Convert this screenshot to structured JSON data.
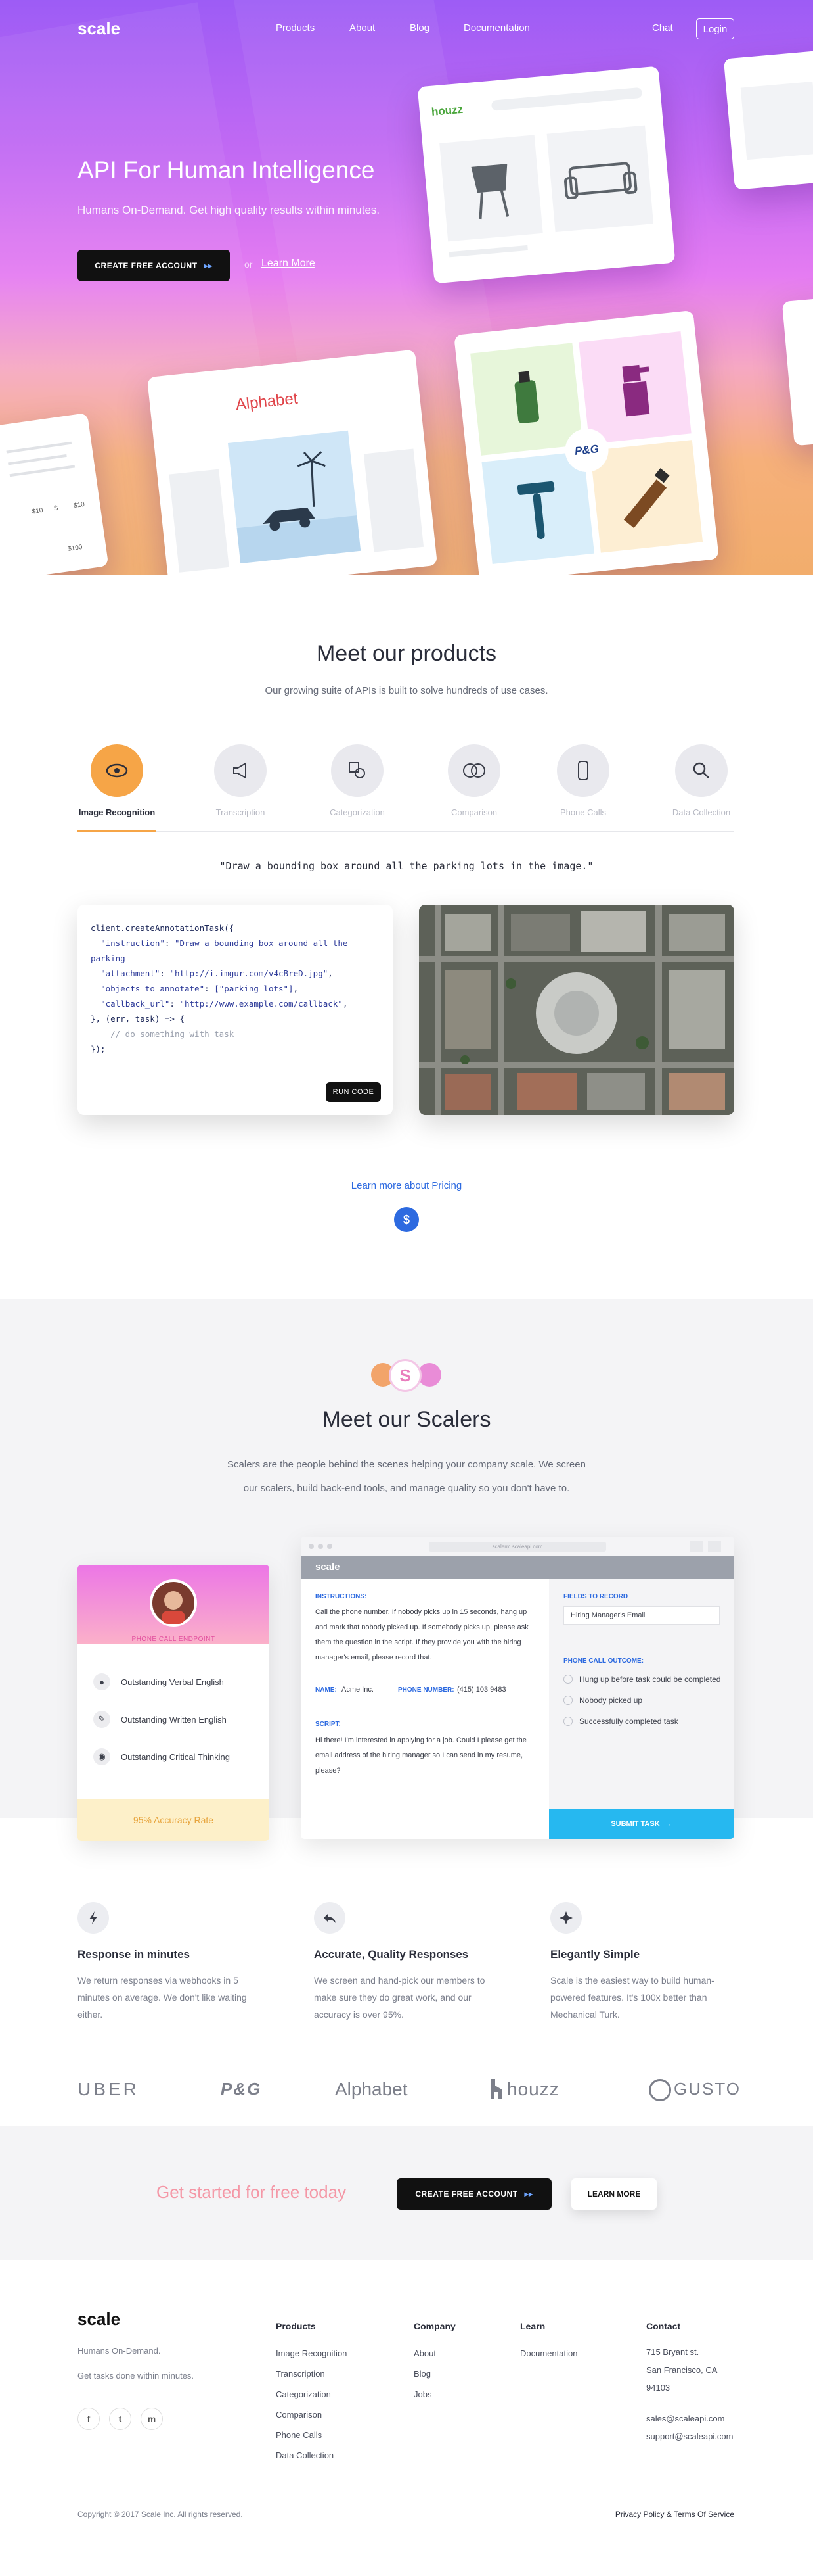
{
  "nav": {
    "logo": "scale",
    "links": [
      "Products",
      "About",
      "Blog",
      "Documentation"
    ],
    "chat": "Chat",
    "login": "Login"
  },
  "hero": {
    "title": "API For Human Intelligence",
    "subtitle": "Humans On-Demand. Get high quality results within minutes.",
    "cta": "CREATE FREE ACCOUNT",
    "or": "or",
    "learn_more": "Learn More",
    "cards": {
      "houzz": "houzz",
      "alphabet": "Alphabet",
      "pg": "P&G",
      "prices": [
        "$10",
        "$",
        "$10",
        "$100"
      ]
    }
  },
  "products": {
    "title": "Meet our products",
    "subtitle": "Our growing suite of APIs is built to solve hundreds of use cases.",
    "tabs": [
      {
        "label": "Image Recognition",
        "icon": "eye-icon",
        "active": true
      },
      {
        "label": "Transcription",
        "icon": "megaphone-icon",
        "active": false
      },
      {
        "label": "Categorization",
        "icon": "shapes-icon",
        "active": false
      },
      {
        "label": "Comparison",
        "icon": "rings-icon",
        "active": false
      },
      {
        "label": "Phone Calls",
        "icon": "phone-icon",
        "active": false
      },
      {
        "label": "Data Collection",
        "icon": "search-icon",
        "active": false
      }
    ],
    "instruction": "\"Draw a bounding box around all the parking lots in the image.\"",
    "code": {
      "line1": "client.createAnnotationTask({",
      "line2_key": "\"instruction\"",
      "line2_val": "\"Draw a bounding box around all the parking",
      "line3_key": "\"attachment\"",
      "line3_val": "\"http://i.imgur.com/v4cBreD.jpg\"",
      "line4_key": "\"objects_to_annotate\"",
      "line4_val": "[\"parking lots\"]",
      "line5_key": "\"callback_url\"",
      "line5_val": "\"http://www.example.com/callback\"",
      "line6": "}, (err, task) => {",
      "line7": "// do something with task",
      "line8": "});",
      "run": "RUN CODE"
    },
    "pricing_link": "Learn more about Pricing",
    "pricing_icon": "$"
  },
  "scalers": {
    "badge": "S",
    "title": "Meet our Scalers",
    "subtitle_1": "Scalers are the people behind the scenes helping your company scale. We screen",
    "subtitle_2": "our scalers, build back-end tools, and manage quality so you don't have to.",
    "profile": {
      "role": "PHONE CALL ENDPOINT",
      "skills": [
        "Outstanding Verbal English",
        "Outstanding Written English",
        "Outstanding Critical Thinking"
      ],
      "accuracy": "95% Accuracy Rate"
    },
    "browser": {
      "url": "scalerm.scaleapi.com",
      "app": "scale",
      "instructions_label": "INSTRUCTIONS:",
      "instructions": "Call the phone number. If nobody picks up in 15 seconds, hang up and mark that nobody picked up. If somebody picks up, please ask them the question in the script. If they provide you with the hiring manager's email, please record that.",
      "name_label": "NAME:",
      "name": "Acme Inc.",
      "phone_label": "PHONE NUMBER:",
      "phone": "(415) 103 9483",
      "script_label": "SCRIPT:",
      "script": "Hi there! I'm interested in applying for a job. Could I please get the email address of the hiring manager so I can send in my resume, please?",
      "fields_label": "FIELDS TO RECORD",
      "field_placeholder": "Hiring Manager's Email",
      "outcome_label": "PHONE CALL OUTCOME:",
      "outcomes": [
        "Hung up before task could be completed",
        "Nobody picked up",
        "Successfully completed task"
      ],
      "submit": "SUBMIT TASK"
    }
  },
  "features": [
    {
      "icon": "lightning-icon",
      "title": "Response in minutes",
      "text": "We return responses via webhooks in 5 minutes on average. We don't like waiting either."
    },
    {
      "icon": "reply-arrow-icon",
      "title": "Accurate, Quality Responses",
      "text": "We screen and hand-pick our members to make sure they do great work, and our accuracy is over 95%."
    },
    {
      "icon": "sparkle-icon",
      "title": "Elegantly Simple",
      "text": "Scale is the easiest way to build human-powered features. It's 100x better than Mechanical Turk."
    }
  ],
  "clients": [
    "UBER",
    "P&G",
    "Alphabet",
    "houzz",
    "GUSTO"
  ],
  "cta": {
    "text": "Get started for free today",
    "primary": "CREATE FREE ACCOUNT",
    "secondary": "LEARN MORE"
  },
  "footer": {
    "logo": "scale",
    "tagline_1": "Humans On-Demand.",
    "tagline_2": "Get tasks done within minutes.",
    "social": [
      "f",
      "t",
      "m"
    ],
    "columns": [
      {
        "title": "Products",
        "items": [
          "Image Recognition",
          "Transcription",
          "Categorization",
          "Comparison",
          "Phone Calls",
          "Data Collection"
        ]
      },
      {
        "title": "Company",
        "items": [
          "About",
          "Blog",
          "Jobs"
        ]
      },
      {
        "title": "Learn",
        "items": [
          "Documentation"
        ]
      },
      {
        "title": "Contact",
        "items": [
          "715 Bryant st.",
          "San Francisco, CA",
          "94103",
          "",
          "sales@scaleapi.com",
          "support@scaleapi.com"
        ]
      }
    ],
    "copyright": "Copyright © 2017 Scale Inc. All rights reserved.",
    "legal": "Privacy Policy & Terms Of Service"
  },
  "colors": {
    "accent_orange": "#f6a547",
    "link_blue": "#2d6ae0",
    "cta_pink": "#f497a6",
    "submit_blue": "#26b8f0"
  }
}
